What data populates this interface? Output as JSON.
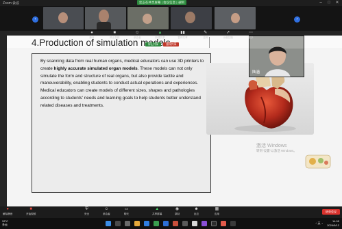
{
  "window": {
    "title": "Zoom 会议",
    "share_banner": "您正在共享屏幕 | 会议信息 | 录制"
  },
  "participants": [
    {
      "label": ""
    },
    {
      "label": ""
    },
    {
      "label": ""
    },
    {
      "label": ""
    },
    {
      "label": ""
    }
  ],
  "toolbar": {
    "items": [
      "静音",
      "停止视频",
      "参会者",
      "新建共享",
      "暂停共享",
      "注释",
      "远程控制",
      "更多"
    ],
    "stop_share": "停止共享",
    "pause_share": "暂停共享"
  },
  "slide": {
    "title": "4.Production of simulation models",
    "para1_a": "By scanning data from real human organs, medical educators can use 3D printers to create ",
    "para1_bold": "highly accurate simulated organ models",
    "para1_b": ". These models can not only simulate the form and structure of real organs, but also provide tactile and maneuverability, enabling students to conduct actual operations and experiences.",
    "para2": "Medical educators can create models of different sizes, shapes and pathologies according to students' needs and learning goals to help students better understand related diseases and treatments.",
    "activate_line1": "激活 Windows",
    "activate_line2": "转到\"设置\"以激活 Windows。"
  },
  "self_view": {
    "name": "陆涵"
  },
  "bottom_bar": {
    "items": [
      "解除静音",
      "开始视频",
      "安全",
      "参会者",
      "聊天",
      "共享屏幕",
      "录制",
      "反应",
      "应用"
    ],
    "leave": "结束会议"
  },
  "taskbar": {
    "weather_temp": "28°C",
    "weather_desc": "多云",
    "tray": "^ 英 ◔",
    "time": "14:05",
    "date": "2024/6/12"
  }
}
